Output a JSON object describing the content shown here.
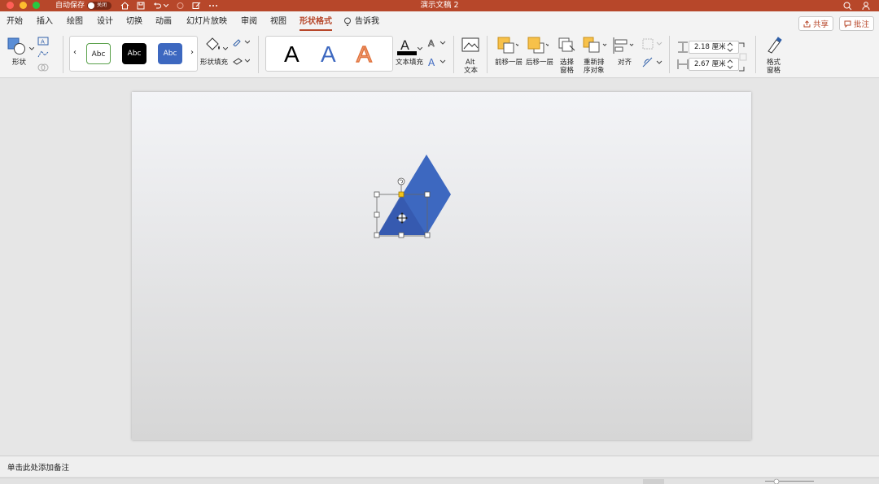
{
  "window": {
    "title": "演示文稿 2",
    "autosave_label": "自动保存",
    "autosave_state": "关闭"
  },
  "menu": {
    "tabs": [
      "开始",
      "插入",
      "绘图",
      "设计",
      "切换",
      "动画",
      "幻灯片放映",
      "审阅",
      "视图",
      "形状格式"
    ],
    "active_tab": "形状格式",
    "tell_me": "告诉我",
    "share": "共享",
    "comment": "批注"
  },
  "ribbon": {
    "shape_label": "形状",
    "style_samples": [
      "Abc",
      "Abc",
      "Abc"
    ],
    "shape_fill": "形状填充",
    "wordart_letter": "A",
    "text_fill": "文本填充",
    "alt_text": [
      "Alt",
      "文本"
    ],
    "bring_forward": "前移一层",
    "send_backward": "后移一层",
    "selection_pane": [
      "选择",
      "窗格"
    ],
    "reorder": [
      "重新排",
      "序对象"
    ],
    "align": "对齐",
    "height_value": "2.18 厘米",
    "width_value": "2.67 厘米",
    "format_pane": [
      "格式",
      "窗格"
    ]
  },
  "notes": {
    "placeholder": "单击此处添加备注"
  },
  "colors": {
    "brand": "#b7472a",
    "shape_fill": "#3d68c0",
    "handle_yellow": "#f5c518"
  },
  "icons": [
    "home-icon",
    "save-icon",
    "undo-icon",
    "redo-icon",
    "search-icon",
    "share-person-icon",
    "lightbulb-icon",
    "paint-bucket-icon",
    "rotate-handle-icon",
    "move-cursor-icon"
  ]
}
